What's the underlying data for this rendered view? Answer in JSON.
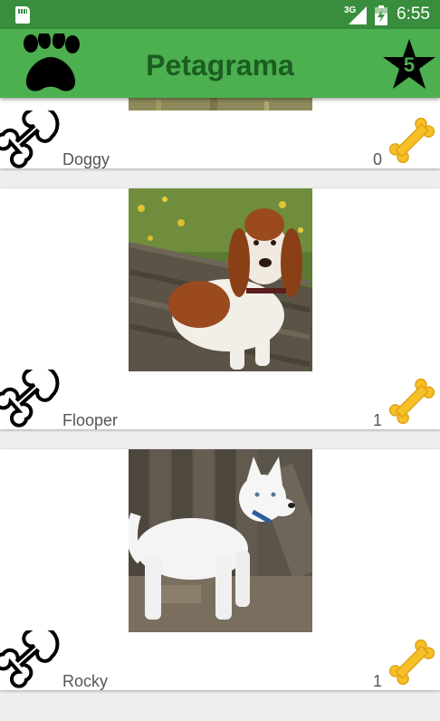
{
  "status": {
    "network": "3G",
    "time": "6:55"
  },
  "toolbar": {
    "title": "Petagrama",
    "star_count": "5"
  },
  "colors": {
    "primary": "#4caf50",
    "primary_dark": "#388e3c",
    "title": "#1b5e20",
    "bone_gold": "#f6c026"
  },
  "pets": [
    {
      "name": "Doggy",
      "likes": "0",
      "photo": "cut-off dog photo (grass)"
    },
    {
      "name": "Flooper",
      "likes": "1",
      "photo": "basset hound sitting on wooden steps"
    },
    {
      "name": "Rocky",
      "likes": "1",
      "photo": "white husky in front of a wooden fence"
    }
  ]
}
